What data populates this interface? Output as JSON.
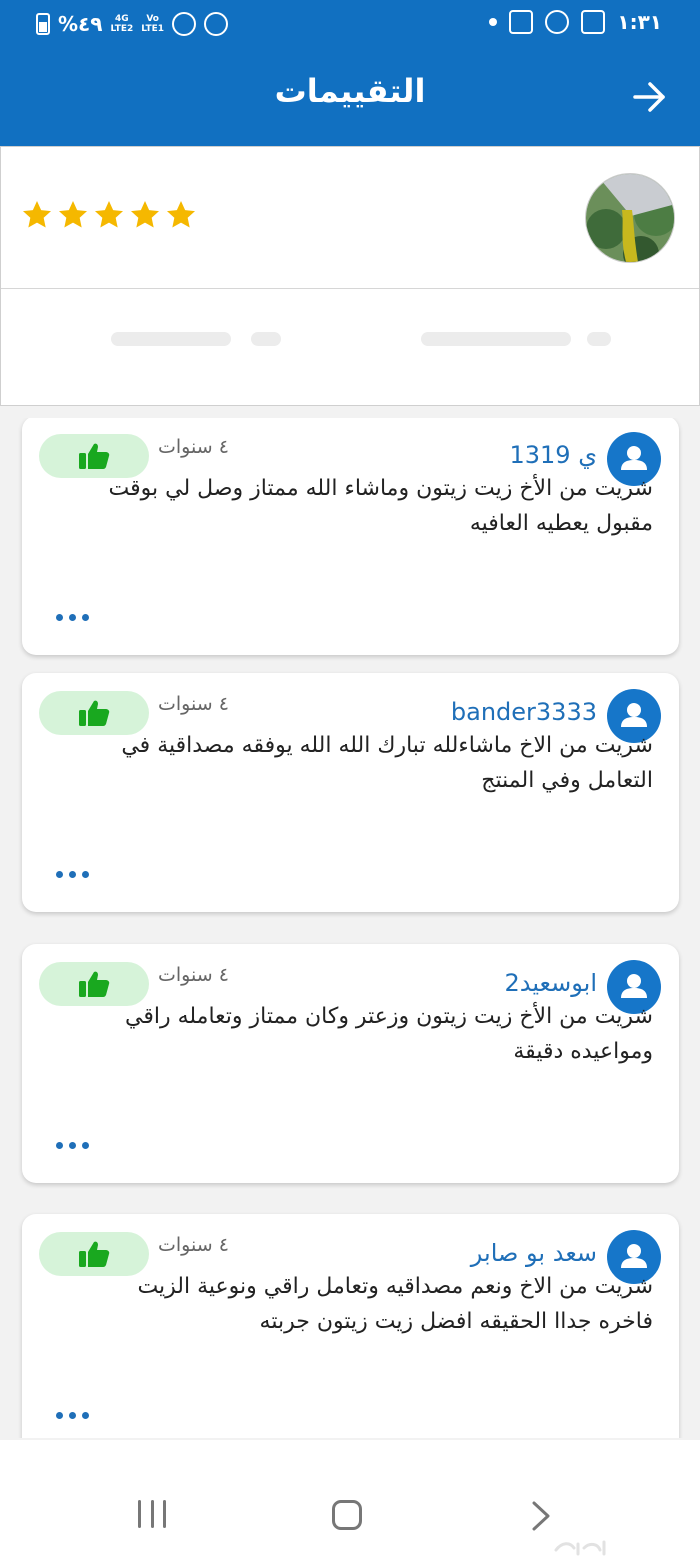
{
  "status_bar": {
    "battery": "%٤٩",
    "signal1": [
      "4G",
      "LTE2"
    ],
    "signal2": [
      "Vo",
      "LTE1"
    ],
    "time": "١:٣١"
  },
  "app_bar": {
    "title": "التقييمات"
  },
  "header": {
    "rating": 5
  },
  "reviews": [
    {
      "username": "ي 1319",
      "time": "٤ سنوات",
      "text": "شريت من الأخ زيت زيتون وماشاء الله ممتاز وصل لي بوقت مقبول يعطيه العافيه"
    },
    {
      "username": "bander3333",
      "time": "٤ سنوات",
      "text": "شريت من الاخ ماشاءلله تبارك الله الله يوفقه مصداقية في التعامل وفي المنتج"
    },
    {
      "username": "ابوسعيد2",
      "time": "٤ سنوات",
      "text": "شريت من الأخ زيت زيتون وزعتر وكان ممتاز وتعامله راقي ومواعيده دقيقة"
    },
    {
      "username": "سعد بو صابر",
      "time": "٤ سنوات",
      "text": "شريت من الاخ ونعم مصداقيه وتعامل راقي  ونوعية الزيت فاخره جداا الحقيقه افضل زيت زيتون جربته"
    }
  ],
  "colors": {
    "primary": "#1170c1",
    "star": "#f5b800",
    "like_bg": "#d6f3d9",
    "like_icon": "#19a81f"
  },
  "icons": {
    "back": "arrow-right-icon",
    "like": "thumbs-up-icon",
    "avatar": "user-icon",
    "more": "more-dots-icon"
  }
}
